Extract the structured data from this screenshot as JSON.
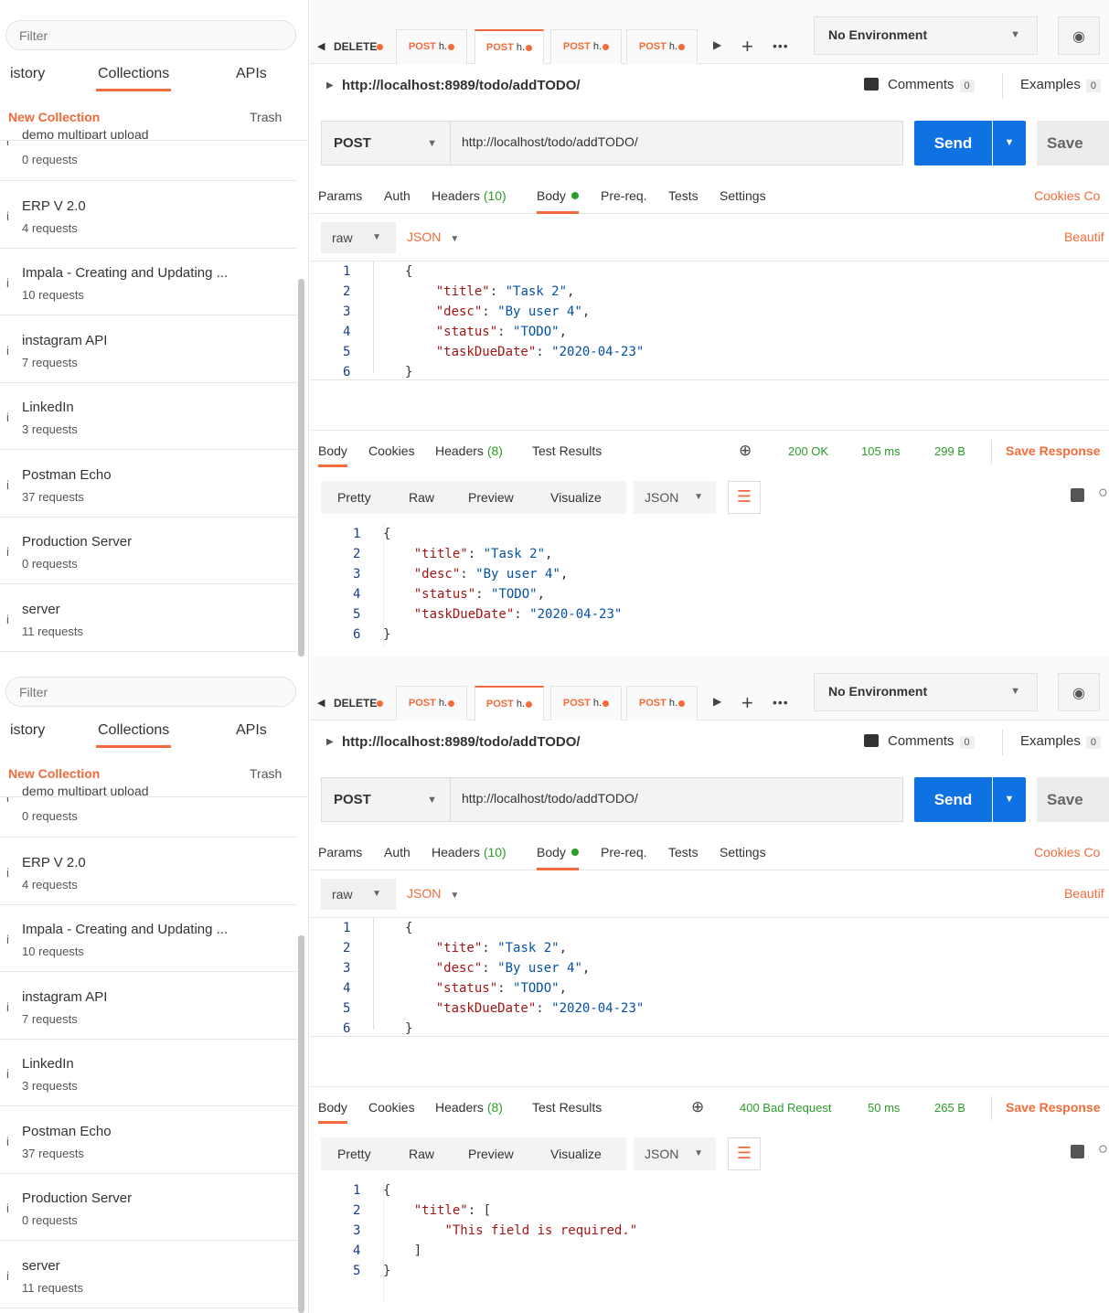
{
  "panels": [
    {
      "sidebar": {
        "filter_placeholder": "Filter",
        "tabs": [
          "istory",
          "Collections",
          "APIs"
        ],
        "new_collection": "New Collection",
        "trash": "Trash",
        "cutoff_item": "demo multipart upload",
        "collections": [
          {
            "name": "",
            "requests": "0 requests"
          },
          {
            "name": "ERP V 2.0",
            "requests": "4 requests"
          },
          {
            "name": "Impala - Creating and Updating ...",
            "requests": "10 requests"
          },
          {
            "name": "instagram API",
            "requests": "7 requests"
          },
          {
            "name": "LinkedIn",
            "requests": "3 requests"
          },
          {
            "name": "Postman Echo",
            "requests": "37 requests"
          },
          {
            "name": "Production Server",
            "requests": "0 requests"
          },
          {
            "name": "server",
            "requests": "11 requests"
          }
        ],
        "item_icon": "i"
      },
      "tabs": {
        "delete_label": "DELETE",
        "request_tabs": [
          {
            "method": "POST",
            "name": "h."
          },
          {
            "method": "POST",
            "name": "h."
          },
          {
            "method": "POST",
            "name": "h."
          },
          {
            "method": "POST",
            "name": "h."
          }
        ],
        "environment": "No Environment"
      },
      "request": {
        "breadcrumb_url": "http://localhost:8989/todo/addTODO/",
        "comments_label": "Comments",
        "comments_count": "0",
        "examples_label": "Examples",
        "examples_count": "0",
        "method": "POST",
        "url": "http://localhost/todo/addTODO/",
        "send_label": "Send",
        "save_label": "Save",
        "tabs": {
          "params": "Params",
          "auth": "Auth",
          "headers": "Headers",
          "headers_count": "(10)",
          "body": "Body",
          "prereq": "Pre-req.",
          "tests": "Tests",
          "settings": "Settings"
        },
        "cookies_label": "Cookies",
        "cookies_tail": "Co",
        "body_mode": "raw",
        "body_format": "JSON",
        "beautify_label": "Beautif",
        "body_lines": [
          {
            "num": "1",
            "text": "{"
          },
          {
            "num": "2",
            "text": "    \"title\": \"Task 2\","
          },
          {
            "num": "3",
            "text": "    \"desc\": \"By user 4\","
          },
          {
            "num": "4",
            "text": "    \"status\": \"TODO\","
          },
          {
            "num": "5",
            "text": "    \"taskDueDate\": \"2020-04-23\""
          },
          {
            "num": "6",
            "text": "}"
          }
        ]
      },
      "response": {
        "tabs": {
          "body": "Body",
          "cookies": "Cookies",
          "headers": "Headers",
          "headers_count": "(8)",
          "test_results": "Test Results"
        },
        "status": "200 OK",
        "time": "105 ms",
        "size": "299 B",
        "save_response": "Save Response",
        "views": [
          "Pretty",
          "Raw",
          "Preview",
          "Visualize"
        ],
        "format": "JSON",
        "lines": [
          {
            "num": "1",
            "text": "{"
          },
          {
            "num": "2",
            "text": "    \"title\": \"Task 2\","
          },
          {
            "num": "3",
            "text": "    \"desc\": \"By user 4\","
          },
          {
            "num": "4",
            "text": "    \"status\": \"TODO\","
          },
          {
            "num": "5",
            "text": "    \"taskDueDate\": \"2020-04-23\""
          },
          {
            "num": "6",
            "text": "}"
          }
        ]
      }
    },
    {
      "sidebar": {
        "filter_placeholder": "Filter",
        "tabs": [
          "istory",
          "Collections",
          "APIs"
        ],
        "new_collection": "New Collection",
        "trash": "Trash",
        "cutoff_item": "demo multipart upload",
        "collections": [
          {
            "name": "",
            "requests": "0 requests"
          },
          {
            "name": "ERP V 2.0",
            "requests": "4 requests"
          },
          {
            "name": "Impala - Creating and Updating ...",
            "requests": "10 requests"
          },
          {
            "name": "instagram API",
            "requests": "7 requests"
          },
          {
            "name": "LinkedIn",
            "requests": "3 requests"
          },
          {
            "name": "Postman Echo",
            "requests": "37 requests"
          },
          {
            "name": "Production Server",
            "requests": "0 requests"
          },
          {
            "name": "server",
            "requests": "11 requests"
          }
        ],
        "item_icon": "i"
      },
      "tabs": {
        "delete_label": "DELETE",
        "request_tabs": [
          {
            "method": "POST",
            "name": "h."
          },
          {
            "method": "POST",
            "name": "h."
          },
          {
            "method": "POST",
            "name": "h."
          },
          {
            "method": "POST",
            "name": "h."
          }
        ],
        "environment": "No Environment"
      },
      "request": {
        "breadcrumb_url": "http://localhost:8989/todo/addTODO/",
        "comments_label": "Comments",
        "comments_count": "0",
        "examples_label": "Examples",
        "examples_count": "0",
        "method": "POST",
        "url": "http://localhost/todo/addTODO/",
        "send_label": "Send",
        "save_label": "Save",
        "tabs": {
          "params": "Params",
          "auth": "Auth",
          "headers": "Headers",
          "headers_count": "(10)",
          "body": "Body",
          "prereq": "Pre-req.",
          "tests": "Tests",
          "settings": "Settings"
        },
        "cookies_label": "Cookies",
        "cookies_tail": "Co",
        "body_mode": "raw",
        "body_format": "JSON",
        "beautify_label": "Beautif",
        "body_lines": [
          {
            "num": "1",
            "text": "{"
          },
          {
            "num": "2",
            "text": "    \"tite\": \"Task 2\","
          },
          {
            "num": "3",
            "text": "    \"desc\": \"By user 4\","
          },
          {
            "num": "4",
            "text": "    \"status\": \"TODO\","
          },
          {
            "num": "5",
            "text": "    \"taskDueDate\": \"2020-04-23\""
          },
          {
            "num": "6",
            "text": "}"
          }
        ]
      },
      "response": {
        "tabs": {
          "body": "Body",
          "cookies": "Cookies",
          "headers": "Headers",
          "headers_count": "(8)",
          "test_results": "Test Results"
        },
        "status": "400 Bad Request",
        "time": "50 ms",
        "size": "265 B",
        "save_response": "Save Response",
        "views": [
          "Pretty",
          "Raw",
          "Preview",
          "Visualize"
        ],
        "format": "JSON",
        "lines": [
          {
            "num": "1",
            "text": "{"
          },
          {
            "num": "2",
            "text": "    \"title\": ["
          },
          {
            "num": "3",
            "text": "        \"This field is required.\""
          },
          {
            "num": "4",
            "text": "    ]"
          },
          {
            "num": "5",
            "text": "}"
          }
        ]
      }
    }
  ],
  "colors": {
    "accent": "#f26b3a",
    "send_button": "#0f72e3",
    "success": "#2a9d2a",
    "json_key": "#a31515",
    "json_string": "#0451a5"
  }
}
